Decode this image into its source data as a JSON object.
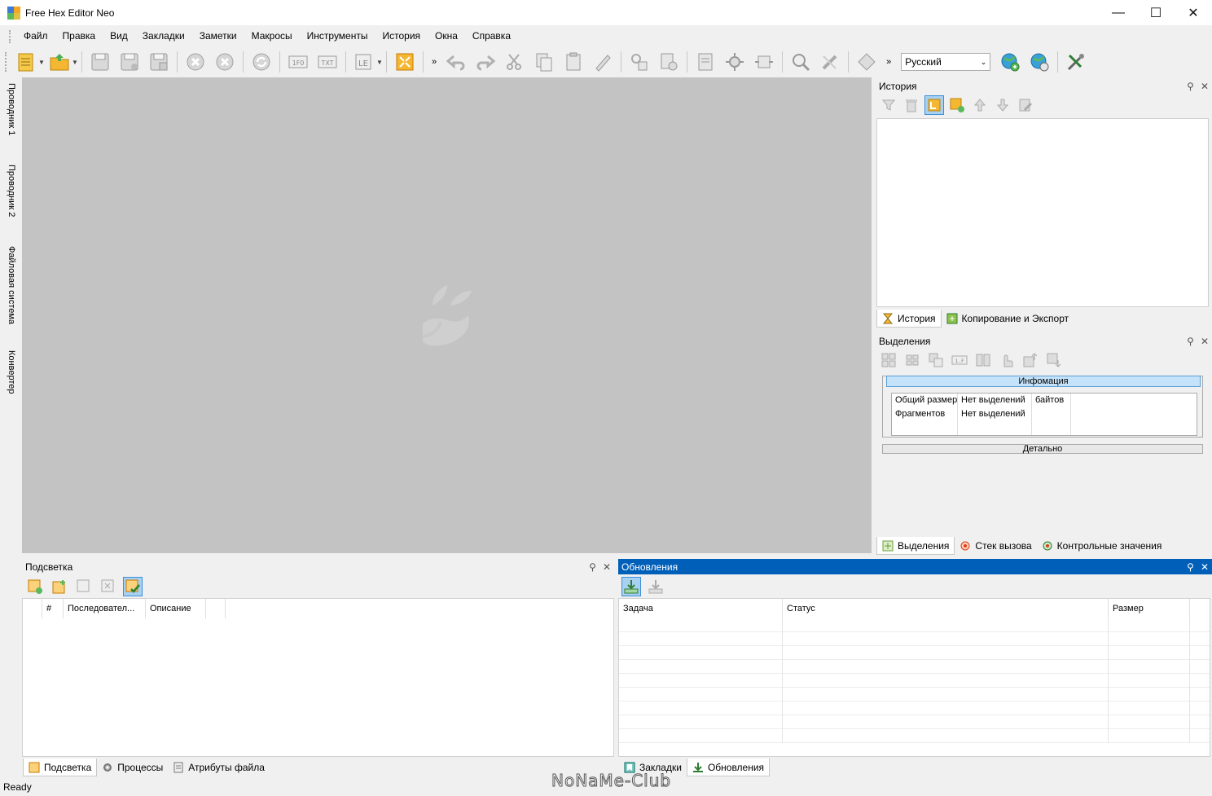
{
  "window": {
    "title": "Free Hex Editor Neo",
    "minimize": "—",
    "maximize": "☐",
    "close": "✕"
  },
  "menu": [
    "Файл",
    "Правка",
    "Вид",
    "Закладки",
    "Заметки",
    "Макросы",
    "Инструменты",
    "История",
    "Окна",
    "Справка"
  ],
  "toolbar": {
    "language": "Русский",
    "icons": [
      "new-file-icon",
      "open-file-icon",
      "save-icon",
      "save-as-icon",
      "save-all-icon",
      "close-icon",
      "close-all-icon",
      "reload-icon",
      "hex-mode-icon",
      "text-mode-icon",
      "encoding-icon",
      "fullscreen-icon",
      "undo-icon",
      "redo-icon",
      "cut-icon",
      "copy-icon",
      "paste-icon",
      "clear-icon",
      "find-replace-icon",
      "copy-special-icon",
      "print-icon",
      "settings-icon",
      "expand-icon",
      "search-icon",
      "tools-icon",
      "patch-icon",
      "web-update-icon",
      "web-info-icon",
      "options-icon"
    ]
  },
  "left_tabs": [
    "Проводник 1",
    "Проводник 2",
    "Файловая система",
    "Конвертер"
  ],
  "history_panel": {
    "title": "История",
    "tabs": [
      {
        "label": "История",
        "icon": "hourglass-icon"
      },
      {
        "label": "Копирование и Экспорт",
        "icon": "export-icon"
      }
    ]
  },
  "selections_panel": {
    "title": "Выделения",
    "info_title": "Инфомация",
    "rows": [
      [
        "Общий размер",
        "Нет выделений",
        "байтов",
        ""
      ],
      [
        "Фрагментов",
        "Нет выделений",
        "",
        ""
      ],
      [
        "",
        "",
        "",
        ""
      ]
    ],
    "detail_label": "Детально",
    "tabs": [
      {
        "label": "Выделения",
        "icon": "selection-icon"
      },
      {
        "label": "Стек вызова",
        "icon": "callstack-icon"
      },
      {
        "label": "Контрольные значения",
        "icon": "watch-icon"
      }
    ]
  },
  "highlight_panel": {
    "title": "Подсветка",
    "columns": [
      "#",
      "Последовател...",
      "Описание"
    ],
    "tabs": [
      {
        "label": "Подсветка",
        "icon": "highlight-icon"
      },
      {
        "label": "Процессы",
        "icon": "gear-icon"
      },
      {
        "label": "Атрибуты файла",
        "icon": "file-attr-icon"
      }
    ]
  },
  "updates_panel": {
    "title": "Обновления",
    "columns": [
      "Задача",
      "Статус",
      "Размер"
    ],
    "tabs": [
      {
        "label": "Закладки",
        "icon": "bookmark-icon"
      },
      {
        "label": "Обновления",
        "icon": "download-icon"
      }
    ]
  },
  "status": {
    "text": "Ready"
  },
  "watermark": "NoNaMe-Club",
  "colors": {
    "accent": "#005fb8",
    "workspace": "#c3c3c3",
    "selected_tool": "#a8d0f0"
  }
}
